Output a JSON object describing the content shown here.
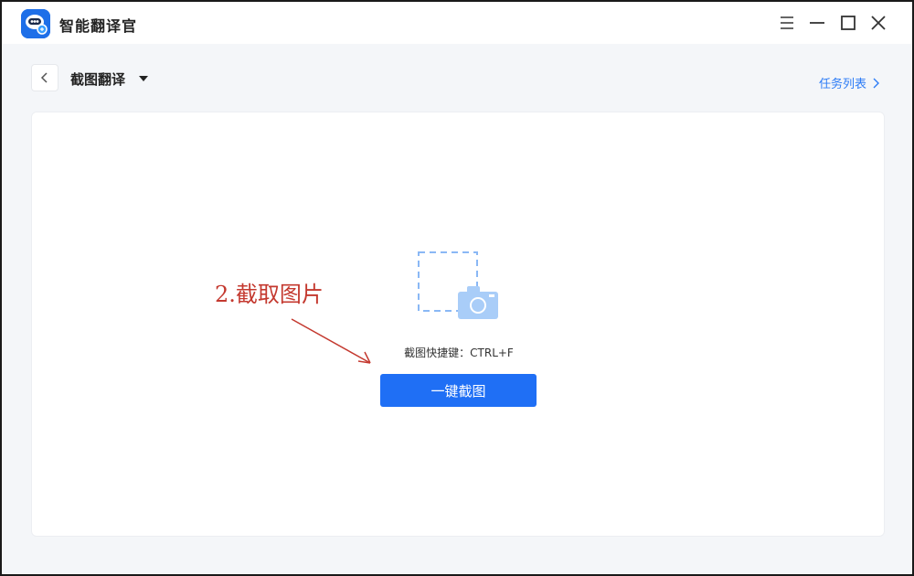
{
  "app": {
    "title": "智能翻译官",
    "icon": "robot-chat-icon"
  },
  "window_controls": {
    "menu_icon": "menu-icon",
    "minimize_icon": "minimize-icon",
    "maximize_icon": "maximize-icon",
    "close_icon": "close-icon"
  },
  "header": {
    "page_title": "截图翻译",
    "task_list_label": "任务列表"
  },
  "main": {
    "shortcut_label": "截图快捷键：CTRL+F",
    "capture_button_label": "一键截图",
    "illustration_icon": "camera-capture-icon"
  },
  "annotation": {
    "label": "2.截取图片"
  },
  "colors": {
    "accent": "#1f6ff5",
    "link": "#2d7cf6",
    "annotation": "#c4392f",
    "background": "#f4f6f9"
  }
}
